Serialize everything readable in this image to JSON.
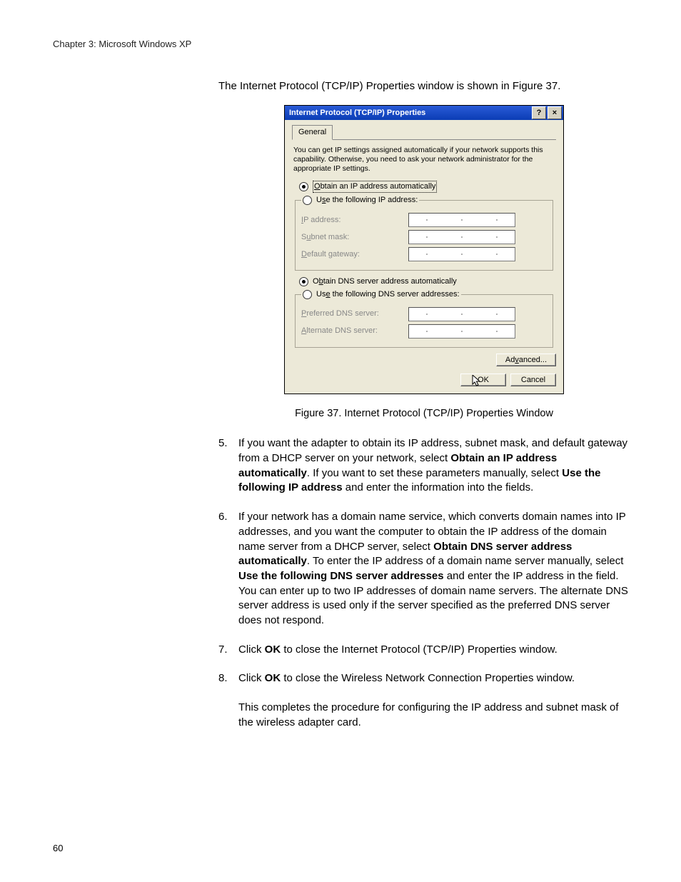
{
  "header": {
    "chapter": "Chapter 3: Microsoft Windows XP"
  },
  "intro": "The Internet Protocol (TCP/IP) Properties window is shown in Figure 37.",
  "dialog": {
    "title": "Internet Protocol (TCP/IP) Properties",
    "help_btn": "?",
    "close_btn": "×",
    "tab": "General",
    "description": "You can get IP settings assigned automatically if your network supports this capability. Otherwise, you need to ask your network administrator for the appropriate IP settings.",
    "ip_auto_prefix": "O",
    "ip_auto_rest": "btain an IP address automatically",
    "ip_manual_prefix_pre": "U",
    "ip_manual_prefix_ul": "s",
    "ip_manual_rest": "e the following IP address:",
    "ip_label_ul": "I",
    "ip_label_rest": "P address:",
    "subnet_label_pre": "S",
    "subnet_label_ul": "u",
    "subnet_label_rest": "bnet mask:",
    "gateway_label_ul": "D",
    "gateway_label_rest": "efault gateway:",
    "dns_auto_pre": "O",
    "dns_auto_ul": "b",
    "dns_auto_rest": "tain DNS server address automatically",
    "dns_manual_pre": "Us",
    "dns_manual_ul": "e",
    "dns_manual_rest": " the following DNS server addresses:",
    "pref_dns_ul": "P",
    "pref_dns_rest": "referred DNS server:",
    "alt_dns_ul": "A",
    "alt_dns_rest": "lternate DNS server:",
    "advanced_pre": "Ad",
    "advanced_ul": "v",
    "advanced_rest": "anced...",
    "ok": "OK",
    "cancel": "Cancel"
  },
  "caption": "Figure 37. Internet Protocol (TCP/IP) Properties Window",
  "steps": {
    "s5": {
      "num": "5.",
      "t1": "If you want the adapter to obtain its IP address, subnet mask, and default gateway from a DHCP server on your network, select ",
      "b1": "Obtain an IP address automatically",
      "t2": ". If you want to set these parameters manually, select ",
      "b2": "Use the following IP address",
      "t3": " and enter the information into the fields."
    },
    "s6": {
      "num": "6.",
      "t1": "If your network has a domain name service, which converts domain names into IP addresses, and you want the computer to obtain the IP address of the domain name server from a DHCP server, select ",
      "b1": "Obtain DNS server address automatically",
      "t2": ". To enter the IP address of a domain name server manually, select ",
      "b2": "Use the following DNS server addresses",
      "t3": " and enter the IP address in the field. You can enter up to two IP addresses of domain name servers. The alternate DNS server address is used only if the server specified as the preferred DNS server does not respond."
    },
    "s7": {
      "num": "7.",
      "t1": "Click ",
      "b1": "OK",
      "t2": " to close the Internet Protocol (TCP/IP) Properties window."
    },
    "s8": {
      "num": "8.",
      "t1": "Click ",
      "b1": "OK",
      "t2": " to close the Wireless Network Connection Properties window."
    }
  },
  "closing": "This completes the procedure for configuring the IP address and subnet mask of the wireless adapter card.",
  "page_number": "60"
}
